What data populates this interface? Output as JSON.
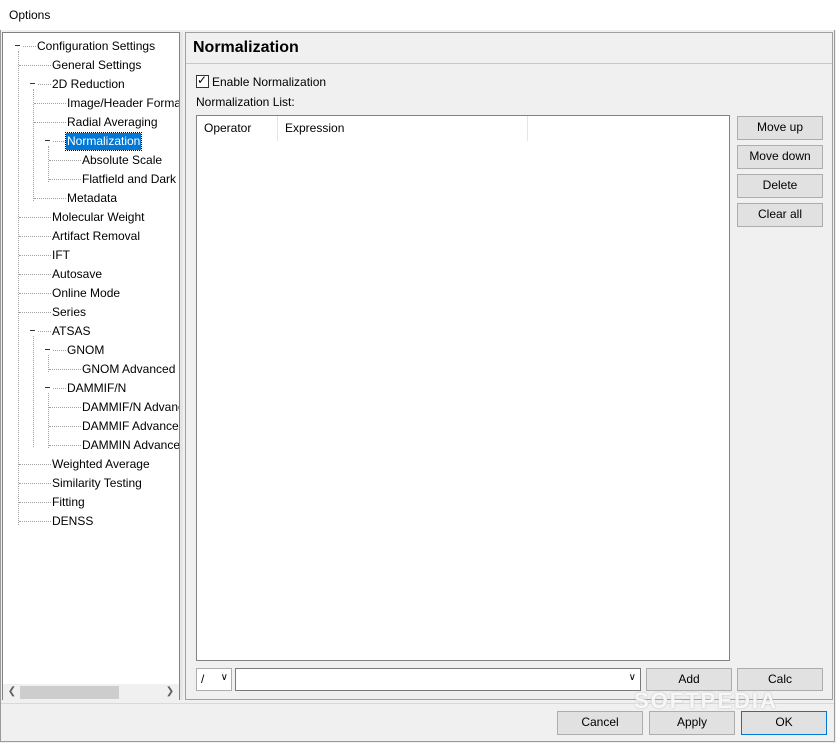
{
  "window": {
    "title": "Options"
  },
  "tree": {
    "items": [
      "Configuration Settings",
      "General Settings",
      "2D Reduction",
      "Image/Header Format",
      "Radial Averaging",
      "Normalization",
      "Absolute Scale",
      "Flatfield and Dark",
      "Metadata",
      "Molecular Weight",
      "Artifact Removal",
      "IFT",
      "Autosave",
      "Online Mode",
      "Series",
      "ATSAS",
      "GNOM",
      "GNOM Advanced",
      "DAMMIF/N",
      "DAMMIF/N Advanced",
      "DAMMIF Advanced",
      "DAMMIN Advanced",
      "Weighted Average",
      "Similarity Testing",
      "Fitting",
      "DENSS"
    ],
    "selected": "Normalization"
  },
  "panel": {
    "title": "Normalization",
    "enable_label": "Enable Normalization",
    "enable_checked": "✓",
    "list_label": "Normalization List:",
    "columns": [
      "Operator",
      "Expression"
    ],
    "side_buttons": [
      "Move up",
      "Move down",
      "Delete",
      "Clear all"
    ],
    "operator_value": "/",
    "expression_value": "",
    "add_label": "Add",
    "calc_label": "Calc"
  },
  "footer": {
    "cancel": "Cancel",
    "apply": "Apply",
    "ok": "OK"
  },
  "watermark": "SOFTPEDIA",
  "icons": {
    "collapse": "collapse-icon",
    "dropdown": "chevron-down-icon",
    "scroll_left": "chevron-left-icon",
    "scroll_right": "chevron-right-icon"
  },
  "colors": {
    "selection": "#0078d7",
    "default_button_border": "#0078d7"
  }
}
